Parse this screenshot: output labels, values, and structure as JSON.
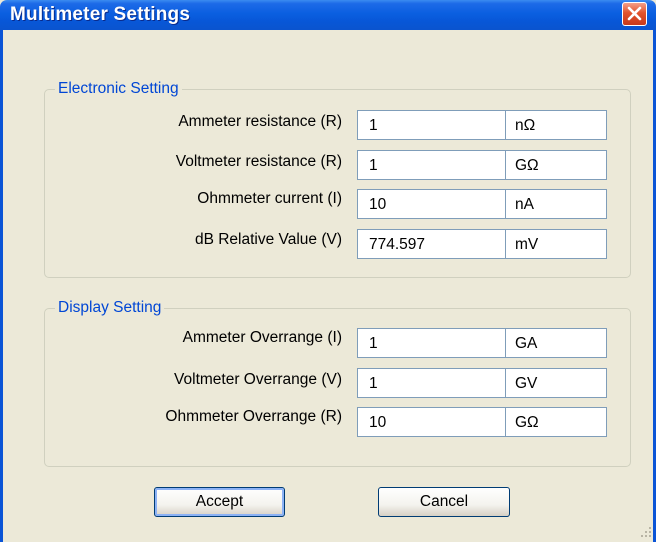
{
  "window": {
    "title": "Multimeter Settings"
  },
  "electronic_setting": {
    "legend": "Electronic Setting",
    "rows": [
      {
        "label": "Ammeter resistance (R)",
        "value": "1",
        "unit": "nΩ"
      },
      {
        "label": "Voltmeter resistance (R)",
        "value": "1",
        "unit": "GΩ"
      },
      {
        "label": "Ohmmeter current (I)",
        "value": "10",
        "unit": "nA"
      },
      {
        "label": "dB Relative Value (V)",
        "value": "774.597",
        "unit": "mV"
      }
    ]
  },
  "display_setting": {
    "legend": "Display Setting",
    "rows": [
      {
        "label": "Ammeter Overrange (I)",
        "value": "1",
        "unit": "GA"
      },
      {
        "label": "Voltmeter Overrange (V)",
        "value": "1",
        "unit": "GV"
      },
      {
        "label": "Ohmmeter Overrange (R)",
        "value": "10",
        "unit": "GΩ"
      }
    ]
  },
  "buttons": {
    "accept": "Accept",
    "cancel": "Cancel"
  },
  "colors": {
    "titlebar": "#0a5fe0",
    "legend_text": "#0046d5",
    "dialog_bg": "#ece9d8",
    "close_button": "#e2532c"
  },
  "icons": {
    "close": "close-icon",
    "resize": "resize-grip-icon"
  }
}
